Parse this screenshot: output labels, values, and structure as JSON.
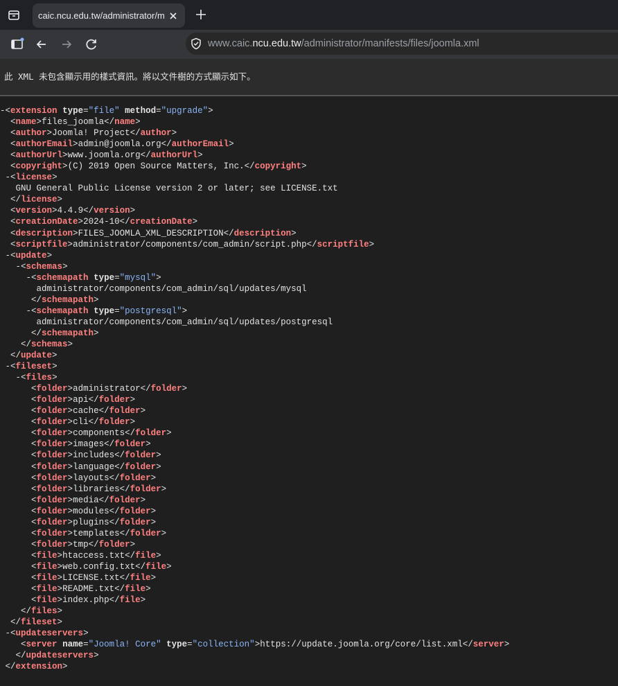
{
  "browser": {
    "tab_title": "caic.ncu.edu.tw/administrator/manifests/files/joomla.xml",
    "url_prefix": "www.caic.",
    "url_host": "ncu.edu.tw",
    "url_path": "/administrator/manifests/files/joomla.xml"
  },
  "infobar_text": "此 XML 未包含顯示用的樣式資訊。將以文件樹的方式顯示如下。",
  "xml_lines": [
    {
      "indent": 0,
      "fold": true,
      "t": [
        [
          "br",
          "<"
        ],
        [
          "tag",
          "extension"
        ],
        [
          "txt",
          " "
        ],
        [
          "attr",
          "type"
        ],
        [
          "br",
          "="
        ],
        [
          "val",
          "\"file\""
        ],
        [
          "txt",
          " "
        ],
        [
          "attr",
          "method"
        ],
        [
          "br",
          "="
        ],
        [
          "val",
          "\"upgrade\""
        ],
        [
          "br",
          ">"
        ]
      ]
    },
    {
      "indent": 2,
      "t": [
        [
          "br",
          "<"
        ],
        [
          "tag",
          "name"
        ],
        [
          "br",
          ">"
        ],
        [
          "txt",
          "files_joomla"
        ],
        [
          "br",
          "</"
        ],
        [
          "tag",
          "name"
        ],
        [
          "br",
          ">"
        ]
      ]
    },
    {
      "indent": 2,
      "t": [
        [
          "br",
          "<"
        ],
        [
          "tag",
          "author"
        ],
        [
          "br",
          ">"
        ],
        [
          "txt",
          "Joomla! Project"
        ],
        [
          "br",
          "</"
        ],
        [
          "tag",
          "author"
        ],
        [
          "br",
          ">"
        ]
      ]
    },
    {
      "indent": 2,
      "t": [
        [
          "br",
          "<"
        ],
        [
          "tag",
          "authorEmail"
        ],
        [
          "br",
          ">"
        ],
        [
          "txt",
          "admin@joomla.org"
        ],
        [
          "br",
          "</"
        ],
        [
          "tag",
          "authorEmail"
        ],
        [
          "br",
          ">"
        ]
      ]
    },
    {
      "indent": 2,
      "t": [
        [
          "br",
          "<"
        ],
        [
          "tag",
          "authorUrl"
        ],
        [
          "br",
          ">"
        ],
        [
          "txt",
          "www.joomla.org"
        ],
        [
          "br",
          "</"
        ],
        [
          "tag",
          "authorUrl"
        ],
        [
          "br",
          ">"
        ]
      ]
    },
    {
      "indent": 2,
      "t": [
        [
          "br",
          "<"
        ],
        [
          "tag",
          "copyright"
        ],
        [
          "br",
          ">"
        ],
        [
          "txt",
          "(C) 2019 Open Source Matters, Inc."
        ],
        [
          "br",
          "</"
        ],
        [
          "tag",
          "copyright"
        ],
        [
          "br",
          ">"
        ]
      ]
    },
    {
      "indent": 1,
      "fold": true,
      "t": [
        [
          "br",
          "<"
        ],
        [
          "tag",
          "license"
        ],
        [
          "br",
          ">"
        ]
      ]
    },
    {
      "indent": 3,
      "t": [
        [
          "txt",
          "GNU General Public License version 2 or later; see LICENSE.txt"
        ]
      ]
    },
    {
      "indent": 2,
      "t": [
        [
          "br",
          "</"
        ],
        [
          "tag",
          "license"
        ],
        [
          "br",
          ">"
        ]
      ]
    },
    {
      "indent": 2,
      "t": [
        [
          "br",
          "<"
        ],
        [
          "tag",
          "version"
        ],
        [
          "br",
          ">"
        ],
        [
          "txt",
          "4.4.9"
        ],
        [
          "br",
          "</"
        ],
        [
          "tag",
          "version"
        ],
        [
          "br",
          ">"
        ]
      ]
    },
    {
      "indent": 2,
      "t": [
        [
          "br",
          "<"
        ],
        [
          "tag",
          "creationDate"
        ],
        [
          "br",
          ">"
        ],
        [
          "txt",
          "2024-10"
        ],
        [
          "br",
          "</"
        ],
        [
          "tag",
          "creationDate"
        ],
        [
          "br",
          ">"
        ]
      ]
    },
    {
      "indent": 2,
      "t": [
        [
          "br",
          "<"
        ],
        [
          "tag",
          "description"
        ],
        [
          "br",
          ">"
        ],
        [
          "txt",
          "FILES_JOOMLA_XML_DESCRIPTION"
        ],
        [
          "br",
          "</"
        ],
        [
          "tag",
          "description"
        ],
        [
          "br",
          ">"
        ]
      ]
    },
    {
      "indent": 2,
      "t": [
        [
          "br",
          "<"
        ],
        [
          "tag",
          "scriptfile"
        ],
        [
          "br",
          ">"
        ],
        [
          "txt",
          "administrator/components/com_admin/script.php"
        ],
        [
          "br",
          "</"
        ],
        [
          "tag",
          "scriptfile"
        ],
        [
          "br",
          ">"
        ]
      ]
    },
    {
      "indent": 1,
      "fold": true,
      "t": [
        [
          "br",
          "<"
        ],
        [
          "tag",
          "update"
        ],
        [
          "br",
          ">"
        ]
      ]
    },
    {
      "indent": 3,
      "fold": true,
      "t": [
        [
          "br",
          "<"
        ],
        [
          "tag",
          "schemas"
        ],
        [
          "br",
          ">"
        ]
      ]
    },
    {
      "indent": 5,
      "fold": true,
      "t": [
        [
          "br",
          "<"
        ],
        [
          "tag",
          "schemapath"
        ],
        [
          "txt",
          " "
        ],
        [
          "attr",
          "type"
        ],
        [
          "br",
          "="
        ],
        [
          "val",
          "\"mysql\""
        ],
        [
          "br",
          ">"
        ]
      ]
    },
    {
      "indent": 7,
      "t": [
        [
          "txt",
          "administrator/components/com_admin/sql/updates/mysql"
        ]
      ]
    },
    {
      "indent": 6,
      "t": [
        [
          "br",
          "</"
        ],
        [
          "tag",
          "schemapath"
        ],
        [
          "br",
          ">"
        ]
      ]
    },
    {
      "indent": 5,
      "fold": true,
      "t": [
        [
          "br",
          "<"
        ],
        [
          "tag",
          "schemapath"
        ],
        [
          "txt",
          " "
        ],
        [
          "attr",
          "type"
        ],
        [
          "br",
          "="
        ],
        [
          "val",
          "\"postgresql\""
        ],
        [
          "br",
          ">"
        ]
      ]
    },
    {
      "indent": 7,
      "t": [
        [
          "txt",
          "administrator/components/com_admin/sql/updates/postgresql"
        ]
      ]
    },
    {
      "indent": 6,
      "t": [
        [
          "br",
          "</"
        ],
        [
          "tag",
          "schemapath"
        ],
        [
          "br",
          ">"
        ]
      ]
    },
    {
      "indent": 4,
      "t": [
        [
          "br",
          "</"
        ],
        [
          "tag",
          "schemas"
        ],
        [
          "br",
          ">"
        ]
      ]
    },
    {
      "indent": 2,
      "t": [
        [
          "br",
          "</"
        ],
        [
          "tag",
          "update"
        ],
        [
          "br",
          ">"
        ]
      ]
    },
    {
      "indent": 1,
      "fold": true,
      "t": [
        [
          "br",
          "<"
        ],
        [
          "tag",
          "fileset"
        ],
        [
          "br",
          ">"
        ]
      ]
    },
    {
      "indent": 3,
      "fold": true,
      "t": [
        [
          "br",
          "<"
        ],
        [
          "tag",
          "files"
        ],
        [
          "br",
          ">"
        ]
      ]
    },
    {
      "indent": 6,
      "t": [
        [
          "br",
          "<"
        ],
        [
          "tag",
          "folder"
        ],
        [
          "br",
          ">"
        ],
        [
          "txt",
          "administrator"
        ],
        [
          "br",
          "</"
        ],
        [
          "tag",
          "folder"
        ],
        [
          "br",
          ">"
        ]
      ]
    },
    {
      "indent": 6,
      "t": [
        [
          "br",
          "<"
        ],
        [
          "tag",
          "folder"
        ],
        [
          "br",
          ">"
        ],
        [
          "txt",
          "api"
        ],
        [
          "br",
          "</"
        ],
        [
          "tag",
          "folder"
        ],
        [
          "br",
          ">"
        ]
      ]
    },
    {
      "indent": 6,
      "t": [
        [
          "br",
          "<"
        ],
        [
          "tag",
          "folder"
        ],
        [
          "br",
          ">"
        ],
        [
          "txt",
          "cache"
        ],
        [
          "br",
          "</"
        ],
        [
          "tag",
          "folder"
        ],
        [
          "br",
          ">"
        ]
      ]
    },
    {
      "indent": 6,
      "t": [
        [
          "br",
          "<"
        ],
        [
          "tag",
          "folder"
        ],
        [
          "br",
          ">"
        ],
        [
          "txt",
          "cli"
        ],
        [
          "br",
          "</"
        ],
        [
          "tag",
          "folder"
        ],
        [
          "br",
          ">"
        ]
      ]
    },
    {
      "indent": 6,
      "t": [
        [
          "br",
          "<"
        ],
        [
          "tag",
          "folder"
        ],
        [
          "br",
          ">"
        ],
        [
          "txt",
          "components"
        ],
        [
          "br",
          "</"
        ],
        [
          "tag",
          "folder"
        ],
        [
          "br",
          ">"
        ]
      ]
    },
    {
      "indent": 6,
      "t": [
        [
          "br",
          "<"
        ],
        [
          "tag",
          "folder"
        ],
        [
          "br",
          ">"
        ],
        [
          "txt",
          "images"
        ],
        [
          "br",
          "</"
        ],
        [
          "tag",
          "folder"
        ],
        [
          "br",
          ">"
        ]
      ]
    },
    {
      "indent": 6,
      "t": [
        [
          "br",
          "<"
        ],
        [
          "tag",
          "folder"
        ],
        [
          "br",
          ">"
        ],
        [
          "txt",
          "includes"
        ],
        [
          "br",
          "</"
        ],
        [
          "tag",
          "folder"
        ],
        [
          "br",
          ">"
        ]
      ]
    },
    {
      "indent": 6,
      "t": [
        [
          "br",
          "<"
        ],
        [
          "tag",
          "folder"
        ],
        [
          "br",
          ">"
        ],
        [
          "txt",
          "language"
        ],
        [
          "br",
          "</"
        ],
        [
          "tag",
          "folder"
        ],
        [
          "br",
          ">"
        ]
      ]
    },
    {
      "indent": 6,
      "t": [
        [
          "br",
          "<"
        ],
        [
          "tag",
          "folder"
        ],
        [
          "br",
          ">"
        ],
        [
          "txt",
          "layouts"
        ],
        [
          "br",
          "</"
        ],
        [
          "tag",
          "folder"
        ],
        [
          "br",
          ">"
        ]
      ]
    },
    {
      "indent": 6,
      "t": [
        [
          "br",
          "<"
        ],
        [
          "tag",
          "folder"
        ],
        [
          "br",
          ">"
        ],
        [
          "txt",
          "libraries"
        ],
        [
          "br",
          "</"
        ],
        [
          "tag",
          "folder"
        ],
        [
          "br",
          ">"
        ]
      ]
    },
    {
      "indent": 6,
      "t": [
        [
          "br",
          "<"
        ],
        [
          "tag",
          "folder"
        ],
        [
          "br",
          ">"
        ],
        [
          "txt",
          "media"
        ],
        [
          "br",
          "</"
        ],
        [
          "tag",
          "folder"
        ],
        [
          "br",
          ">"
        ]
      ]
    },
    {
      "indent": 6,
      "t": [
        [
          "br",
          "<"
        ],
        [
          "tag",
          "folder"
        ],
        [
          "br",
          ">"
        ],
        [
          "txt",
          "modules"
        ],
        [
          "br",
          "</"
        ],
        [
          "tag",
          "folder"
        ],
        [
          "br",
          ">"
        ]
      ]
    },
    {
      "indent": 6,
      "t": [
        [
          "br",
          "<"
        ],
        [
          "tag",
          "folder"
        ],
        [
          "br",
          ">"
        ],
        [
          "txt",
          "plugins"
        ],
        [
          "br",
          "</"
        ],
        [
          "tag",
          "folder"
        ],
        [
          "br",
          ">"
        ]
      ]
    },
    {
      "indent": 6,
      "t": [
        [
          "br",
          "<"
        ],
        [
          "tag",
          "folder"
        ],
        [
          "br",
          ">"
        ],
        [
          "txt",
          "templates"
        ],
        [
          "br",
          "</"
        ],
        [
          "tag",
          "folder"
        ],
        [
          "br",
          ">"
        ]
      ]
    },
    {
      "indent": 6,
      "t": [
        [
          "br",
          "<"
        ],
        [
          "tag",
          "folder"
        ],
        [
          "br",
          ">"
        ],
        [
          "txt",
          "tmp"
        ],
        [
          "br",
          "</"
        ],
        [
          "tag",
          "folder"
        ],
        [
          "br",
          ">"
        ]
      ]
    },
    {
      "indent": 6,
      "t": [
        [
          "br",
          "<"
        ],
        [
          "tag",
          "file"
        ],
        [
          "br",
          ">"
        ],
        [
          "txt",
          "htaccess.txt"
        ],
        [
          "br",
          "</"
        ],
        [
          "tag",
          "file"
        ],
        [
          "br",
          ">"
        ]
      ]
    },
    {
      "indent": 6,
      "t": [
        [
          "br",
          "<"
        ],
        [
          "tag",
          "file"
        ],
        [
          "br",
          ">"
        ],
        [
          "txt",
          "web.config.txt"
        ],
        [
          "br",
          "</"
        ],
        [
          "tag",
          "file"
        ],
        [
          "br",
          ">"
        ]
      ]
    },
    {
      "indent": 6,
      "t": [
        [
          "br",
          "<"
        ],
        [
          "tag",
          "file"
        ],
        [
          "br",
          ">"
        ],
        [
          "txt",
          "LICENSE.txt"
        ],
        [
          "br",
          "</"
        ],
        [
          "tag",
          "file"
        ],
        [
          "br",
          ">"
        ]
      ]
    },
    {
      "indent": 6,
      "t": [
        [
          "br",
          "<"
        ],
        [
          "tag",
          "file"
        ],
        [
          "br",
          ">"
        ],
        [
          "txt",
          "README.txt"
        ],
        [
          "br",
          "</"
        ],
        [
          "tag",
          "file"
        ],
        [
          "br",
          ">"
        ]
      ]
    },
    {
      "indent": 6,
      "t": [
        [
          "br",
          "<"
        ],
        [
          "tag",
          "file"
        ],
        [
          "br",
          ">"
        ],
        [
          "txt",
          "index.php"
        ],
        [
          "br",
          "</"
        ],
        [
          "tag",
          "file"
        ],
        [
          "br",
          ">"
        ]
      ]
    },
    {
      "indent": 4,
      "t": [
        [
          "br",
          "</"
        ],
        [
          "tag",
          "files"
        ],
        [
          "br",
          ">"
        ]
      ]
    },
    {
      "indent": 2,
      "t": [
        [
          "br",
          "</"
        ],
        [
          "tag",
          "fileset"
        ],
        [
          "br",
          ">"
        ]
      ]
    },
    {
      "indent": 1,
      "fold": true,
      "t": [
        [
          "br",
          "<"
        ],
        [
          "tag",
          "updateservers"
        ],
        [
          "br",
          ">"
        ]
      ]
    },
    {
      "indent": 4,
      "t": [
        [
          "br",
          "<"
        ],
        [
          "tag",
          "server"
        ],
        [
          "txt",
          " "
        ],
        [
          "attr",
          "name"
        ],
        [
          "br",
          "="
        ],
        [
          "val",
          "\"Joomla! Core\""
        ],
        [
          "txt",
          " "
        ],
        [
          "attr",
          "type"
        ],
        [
          "br",
          "="
        ],
        [
          "val",
          "\"collection\""
        ],
        [
          "br",
          ">"
        ],
        [
          "txt",
          "https://update.joomla.org/core/list.xml"
        ],
        [
          "br",
          "</"
        ],
        [
          "tag",
          "server"
        ],
        [
          "br",
          ">"
        ]
      ]
    },
    {
      "indent": 3,
      "t": [
        [
          "br",
          "</"
        ],
        [
          "tag",
          "updateservers"
        ],
        [
          "br",
          ">"
        ]
      ]
    },
    {
      "indent": 1,
      "t": [
        [
          "br",
          "</"
        ],
        [
          "tag",
          "extension"
        ],
        [
          "br",
          ">"
        ]
      ]
    }
  ]
}
